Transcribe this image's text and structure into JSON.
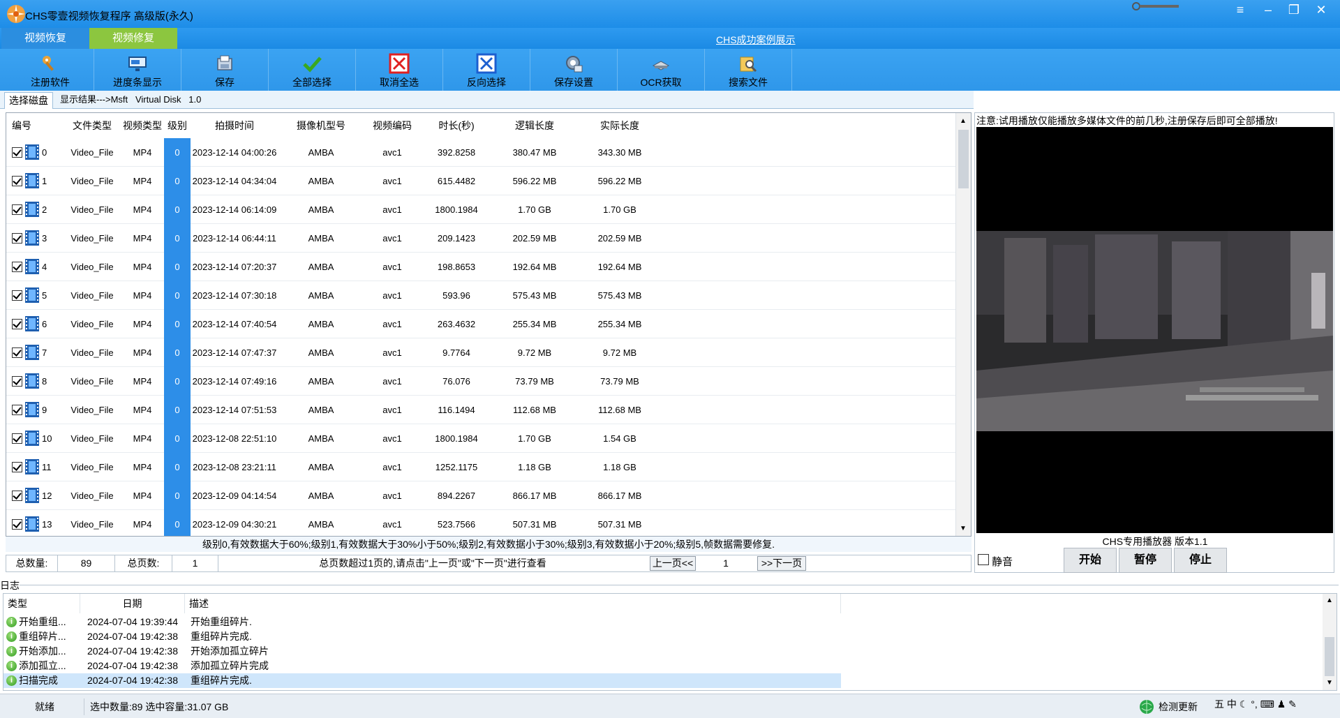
{
  "window": {
    "title": "CHS零壹视频恢复程序 高级版(永久)",
    "controls": [
      "≡",
      "‒",
      "❐",
      "✕"
    ]
  },
  "tabs": {
    "recover": "视频恢复",
    "repair": "视频修复",
    "cases_link": "CHS成功案例展示"
  },
  "toolbar": [
    {
      "label": "注册软件",
      "icon": "key-icon"
    },
    {
      "label": "进度条显示",
      "icon": "progress-icon"
    },
    {
      "label": "保存",
      "icon": "save-icon"
    },
    {
      "label": "全部选择",
      "icon": "check-icon"
    },
    {
      "label": "取消全选",
      "icon": "uncheck-red-icon"
    },
    {
      "label": "反向选择",
      "icon": "invert-blue-icon"
    },
    {
      "label": "保存设置",
      "icon": "settings-icon"
    },
    {
      "label": "OCR获取",
      "icon": "ocr-icon"
    },
    {
      "label": "搜索文件",
      "icon": "search-folder-icon"
    }
  ],
  "panel_tabs": {
    "disk": "选择磁盘",
    "result": "显示结果--->Msft   Virtual Disk   1.0"
  },
  "table": {
    "headers": [
      "编号",
      "文件类型",
      "视频类型",
      "级别",
      "拍摄时间",
      "摄像机型号",
      "视频编码",
      "时长(秒)",
      "逻辑长度",
      "实际长度"
    ],
    "rows": [
      [
        "0",
        "Video_File",
        "MP4",
        "0",
        "2023-12-14 04:00:26",
        "AMBA",
        "avc1",
        "392.8258",
        "380.47 MB",
        "343.30 MB"
      ],
      [
        "1",
        "Video_File",
        "MP4",
        "0",
        "2023-12-14 04:34:04",
        "AMBA",
        "avc1",
        "615.4482",
        "596.22 MB",
        "596.22 MB"
      ],
      [
        "2",
        "Video_File",
        "MP4",
        "0",
        "2023-12-14 06:14:09",
        "AMBA",
        "avc1",
        "1800.1984",
        "1.70 GB",
        "1.70 GB"
      ],
      [
        "3",
        "Video_File",
        "MP4",
        "0",
        "2023-12-14 06:44:11",
        "AMBA",
        "avc1",
        "209.1423",
        "202.59 MB",
        "202.59 MB"
      ],
      [
        "4",
        "Video_File",
        "MP4",
        "0",
        "2023-12-14 07:20:37",
        "AMBA",
        "avc1",
        "198.8653",
        "192.64 MB",
        "192.64 MB"
      ],
      [
        "5",
        "Video_File",
        "MP4",
        "0",
        "2023-12-14 07:30:18",
        "AMBA",
        "avc1",
        "593.96",
        "575.43 MB",
        "575.43 MB"
      ],
      [
        "6",
        "Video_File",
        "MP4",
        "0",
        "2023-12-14 07:40:54",
        "AMBA",
        "avc1",
        "263.4632",
        "255.34 MB",
        "255.34 MB"
      ],
      [
        "7",
        "Video_File",
        "MP4",
        "0",
        "2023-12-14 07:47:37",
        "AMBA",
        "avc1",
        "9.7764",
        "9.72 MB",
        "9.72 MB"
      ],
      [
        "8",
        "Video_File",
        "MP4",
        "0",
        "2023-12-14 07:49:16",
        "AMBA",
        "avc1",
        "76.076",
        "73.79 MB",
        "73.79 MB"
      ],
      [
        "9",
        "Video_File",
        "MP4",
        "0",
        "2023-12-14 07:51:53",
        "AMBA",
        "avc1",
        "116.1494",
        "112.68 MB",
        "112.68 MB"
      ],
      [
        "10",
        "Video_File",
        "MP4",
        "0",
        "2023-12-08 22:51:10",
        "AMBA",
        "avc1",
        "1800.1984",
        "1.70 GB",
        "1.54 GB"
      ],
      [
        "11",
        "Video_File",
        "MP4",
        "0",
        "2023-12-08 23:21:11",
        "AMBA",
        "avc1",
        "1252.1175",
        "1.18 GB",
        "1.18 GB"
      ],
      [
        "12",
        "Video_File",
        "MP4",
        "0",
        "2023-12-09 04:14:54",
        "AMBA",
        "avc1",
        "894.2267",
        "866.17 MB",
        "866.17 MB"
      ],
      [
        "13",
        "Video_File",
        "MP4",
        "0",
        "2023-12-09 04:30:21",
        "AMBA",
        "avc1",
        "523.7566",
        "507.31 MB",
        "507.31 MB"
      ]
    ]
  },
  "legend": "级别0,有效数据大于60%;级别1,有效数据大于30%小于50%;级别2,有效数据小于30%;级别3,有效数据小于20%;级别5,帧数据需要修复.",
  "pager": {
    "total_label": "总数量:",
    "total": "89",
    "pages_label": "总页数:",
    "pages": "1",
    "hint": "总页数超过1页的,请点击\"上一页\"或\"下一页\"进行查看",
    "prev": "上一页<<",
    "current": "1",
    "next": ">>下一页"
  },
  "player": {
    "note": "注意:试用播放仅能播放多媒体文件的前几秒,注册保存后即可全部播放!",
    "version": "CHS专用播放器 版本1.1",
    "mute": "静音",
    "start": "开始",
    "pause": "暂停",
    "stop": "停止"
  },
  "log": {
    "title": "日志",
    "headers": [
      "类型",
      "日期",
      "描述"
    ],
    "rows": [
      [
        "开始重组...",
        "2024-07-04 19:39:44",
        "开始重组碎片."
      ],
      [
        "重组碎片...",
        "2024-07-04 19:42:38",
        "重组碎片完成."
      ],
      [
        "开始添加...",
        "2024-07-04 19:42:38",
        "开始添加孤立碎片"
      ],
      [
        "添加孤立...",
        "2024-07-04 19:42:38",
        "添加孤立碎片完成"
      ],
      [
        "扫描完成",
        "2024-07-04 19:42:38",
        "重组碎片完成."
      ]
    ]
  },
  "status": {
    "ready": "就绪",
    "selection": "选中数量:89 选中容量:31.07 GB",
    "update": "检测更新",
    "ime": "五 中 ☾ °, ⌨ ♟ ✎"
  },
  "colors": {
    "titlebar": "#1d8de8",
    "repair_tab": "#8cc63f",
    "level_cell": "#2d8ee8"
  }
}
